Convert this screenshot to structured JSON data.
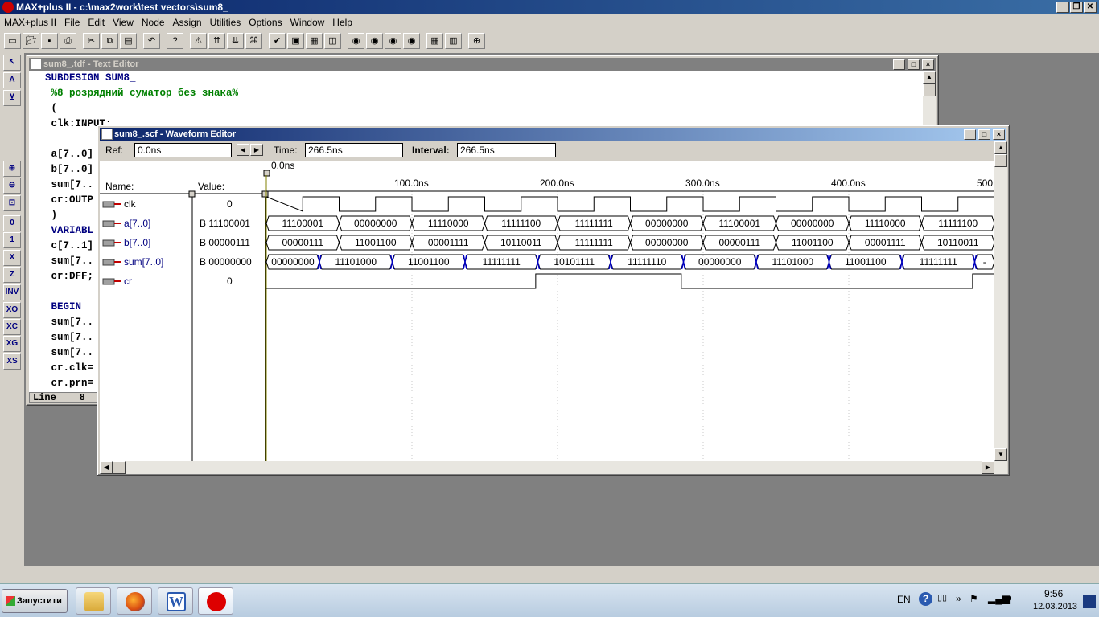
{
  "app": {
    "title": "MAX+plus II - c:\\max2work\\test vectors\\sum8_",
    "menu": [
      "MAX+plus II",
      "File",
      "Edit",
      "View",
      "Node",
      "Assign",
      "Utilities",
      "Options",
      "Window",
      "Help"
    ],
    "caption_buttons": [
      "_",
      "❐",
      "✕"
    ]
  },
  "toolbar_icons": [
    "new-icon",
    "open-icon",
    "save-icon",
    "print-icon",
    "cut-icon",
    "copy-icon",
    "paste-icon",
    "undo-icon",
    "help-pointer-icon",
    "warning-icon",
    "hierarchy-up-icon",
    "hierarchy-down-icon",
    "hierarchy-icon",
    "check-icon",
    "compile-icon",
    "simulate-icon",
    "timing-icon",
    "eye-icon",
    "eye-a-icon",
    "eye-b-icon",
    "eye-c-icon",
    "tile-icon",
    "cascade-icon",
    "zoom-icon"
  ],
  "left_tools": [
    "pointer-icon",
    "text-tool-icon",
    "node-tool-icon",
    "zoom-in-icon",
    "zoom-out-icon",
    "fit-icon",
    "0",
    "1",
    "X",
    "Z",
    "INV",
    "XO",
    "XC",
    "XG",
    "XS"
  ],
  "text_editor": {
    "title": "sum8_.tdf - Text Editor",
    "lines": [
      {
        "text": "SUBDESIGN SUM8_",
        "style": "kw"
      },
      {
        "text": " %8 розрядний суматор без знака%",
        "style": "cm"
      },
      {
        "text": " (",
        "style": ""
      },
      {
        "text": " clk:INPUT;",
        "style": ""
      },
      {
        "text": "",
        "style": ""
      },
      {
        "text": " a[7..0]",
        "style": ""
      },
      {
        "text": " b[7..0]",
        "style": ""
      },
      {
        "text": " sum[7..",
        "style": ""
      },
      {
        "text": " cr:OUTP",
        "style": ""
      },
      {
        "text": " )",
        "style": ""
      },
      {
        "text": " VARIABL",
        "style": "kw"
      },
      {
        "text": " c[7..1]",
        "style": ""
      },
      {
        "text": " sum[7..",
        "style": ""
      },
      {
        "text": " cr:DFF;",
        "style": ""
      },
      {
        "text": "",
        "style": ""
      },
      {
        "text": " BEGIN",
        "style": "kw"
      },
      {
        "text": " sum[7..",
        "style": ""
      },
      {
        "text": " sum[7..",
        "style": ""
      },
      {
        "text": " sum[7..",
        "style": ""
      },
      {
        "text": " cr.clk=",
        "style": ""
      },
      {
        "text": " cr.prn=",
        "style": ""
      }
    ],
    "status_line_label": "Line",
    "status_line_value": "8"
  },
  "waveform_editor": {
    "title": "sum8_.scf - Waveform Editor",
    "ref_label": "Ref:",
    "ref_value": "0.0ns",
    "time_label": "Time:",
    "time_value": "266.5ns",
    "interval_label": "Interval:",
    "interval_value": "266.5ns",
    "cursor_label": "0.0ns",
    "name_header": "Name:",
    "value_header": "Value:",
    "ticks": [
      "100.0ns",
      "200.0ns",
      "300.0ns",
      "400.0ns",
      "500"
    ],
    "signals": [
      {
        "name": "clk",
        "value": "0",
        "kind": "input",
        "type": "clock"
      },
      {
        "name": "a[7..0]",
        "value": "B 11100001",
        "kind": "input-bus",
        "type": "bus",
        "segments": [
          "11100001",
          "00000000",
          "11110000",
          "11111100",
          "11111111",
          "00000000",
          "11100001",
          "00000000",
          "11110000",
          "11111100"
        ]
      },
      {
        "name": "b[7..0]",
        "value": "B 00000111",
        "kind": "input-bus",
        "type": "bus",
        "segments": [
          "00000111",
          "11001100",
          "00001111",
          "10110011",
          "11111111",
          "00000000",
          "00000111",
          "11001100",
          "00001111",
          "10110011"
        ]
      },
      {
        "name": "sum[7..0]",
        "value": "B 00000000",
        "kind": "output-bus",
        "type": "sum",
        "segments": [
          "00000000",
          "11101000",
          "11001100",
          "11111111",
          "10101111",
          "11111110",
          "00000000",
          "11101000",
          "11001100",
          "11111111",
          "-"
        ]
      },
      {
        "name": "cr",
        "value": "0",
        "kind": "output",
        "type": "cr"
      }
    ]
  },
  "taskbar": {
    "start_label": "Запустити",
    "lang": "EN",
    "time": "9:56",
    "date": "12.03.2013",
    "apps": [
      "explorer-icon",
      "firefox-icon",
      "word-icon",
      "maxplus-icon"
    ]
  }
}
